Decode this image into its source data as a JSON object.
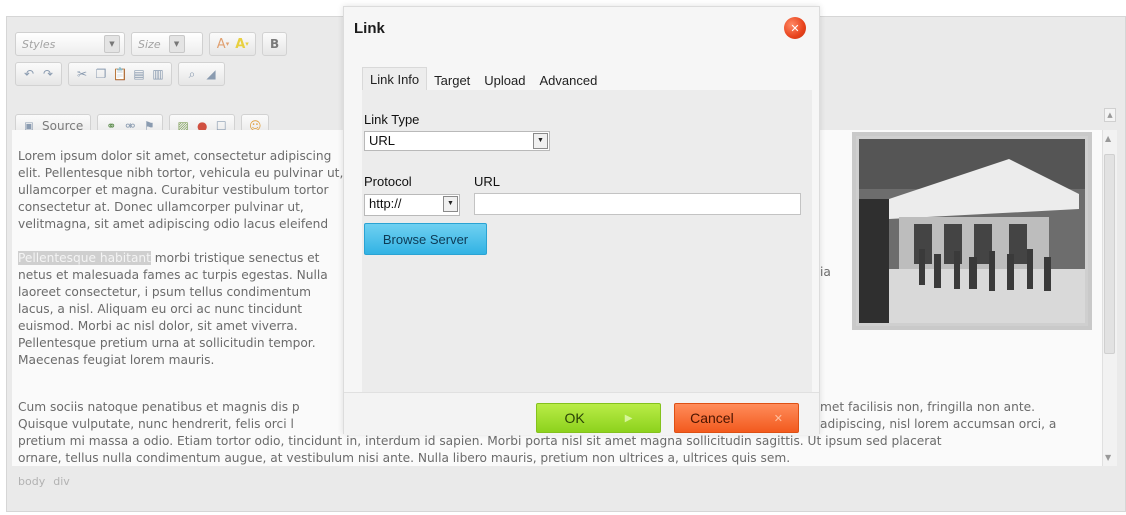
{
  "toolbar": {
    "styles_label": "Styles",
    "size_label": "Size",
    "bold_label": "B",
    "source_label": "Source"
  },
  "content": {
    "para1": "Lorem ipsum dolor sit amet, consectetur adipiscing elit. Pellentesque nibh tortor, vehicula eu pulvinar ut, ullamcorper et magna. Curabitur vestibulum tortor consectetur at. Donec ullamcorper pulvinar ut, velitmagna, sit amet adipiscing odio lacus eleifend",
    "para2_highlight": "Pellentesque habitant",
    "para2_rest": " morbi tristique senectus et netus et malesuada fames ac turpis egestas. Nulla laoreet consectetur, i psum tellus condimentum lacus, a nisl. Aliquam eu orci ac nunc tincidunt euismod. Morbi ac nisl dolor, sit amet viverra. Pellentesque pretium urna at sollicitudin tempor. Maecenas feugiat lorem mauris.",
    "para2_right_fragment": "ia",
    "para3": "Cum sociis natoque penatibus et magnis dis p",
    "para3_right": "met facilisis non, fringilla non ante.",
    "para3_line2_left": "Quisque vulputate, nunc hendrerit, felis orci l",
    "para3_line2_right": "adipiscing, nisl lorem accumsan orci, a",
    "para3_line3": "pretium mi massa a odio. Etiam tortor odio, tincidunt in, interdum id sapien. Morbi porta nisl sit amet magna sollicitudin sagittis. Ut ipsum sed placerat",
    "para3_line4": "ornare, tellus nulla condimentum augue, at vestibulum nisi ante. Nulla libero mauris, pretium non ultrices a, ultrices quis sem."
  },
  "path_bar": [
    "body",
    "div"
  ],
  "dialog": {
    "title": "Link",
    "tabs": [
      "Link Info",
      "Target",
      "Upload",
      "Advanced"
    ],
    "active_tab": "Link Info",
    "link_type_label": "Link Type",
    "link_type_value": "URL",
    "protocol_label": "Protocol",
    "protocol_value": "http://",
    "url_label": "URL",
    "url_value": "",
    "browse_label": "Browse Server",
    "ok_label": "OK",
    "cancel_label": "Cancel"
  },
  "colors": {
    "ok_green": "#8dd21d",
    "cancel_orange": "#f25a1e",
    "browse_blue": "#32b3e4",
    "close_red": "#e8421c"
  }
}
